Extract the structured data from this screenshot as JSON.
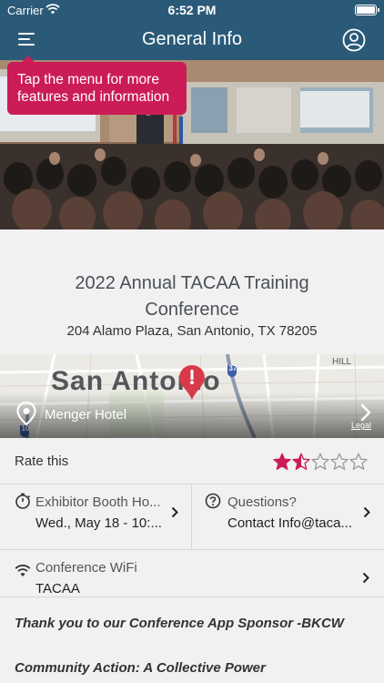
{
  "status_bar": {
    "carrier": "Carrier",
    "time": "6:52 PM"
  },
  "nav": {
    "title": "General Info",
    "menu_icon": "hamburger-menu-icon",
    "profile_icon": "user-circle-icon"
  },
  "tooltip": {
    "text": "Tap the menu for more features and information"
  },
  "event": {
    "title": "2022 Annual TACAA Training Conference",
    "address": "204 Alamo Plaza, San Antonio, TX 78205"
  },
  "map": {
    "location_label": "Menger Hotel",
    "city_label": "San Antonio",
    "hill_label": "HILL",
    "highway_shield_1": "37",
    "highway_shield_2": "10",
    "legal_label": "Legal"
  },
  "rating": {
    "label": "Rate this",
    "value": 1.5,
    "max": 5,
    "accent_color": "#cc1c57"
  },
  "exhibitor": {
    "label": "Exhibitor Booth Ho...",
    "value": "Wed., May 18 - 10:..."
  },
  "questions": {
    "label": "Questions?",
    "value": "Contact Info@taca..."
  },
  "wifi": {
    "label": "Conference WiFi",
    "value": "TACAA"
  },
  "sponsor_text": "Thank you to our Conference App Sponsor -BKCW",
  "motto_text": "Community Action: A Collective Power",
  "colors": {
    "nav_bg": "#2a5a78",
    "accent": "#cc1c57"
  }
}
